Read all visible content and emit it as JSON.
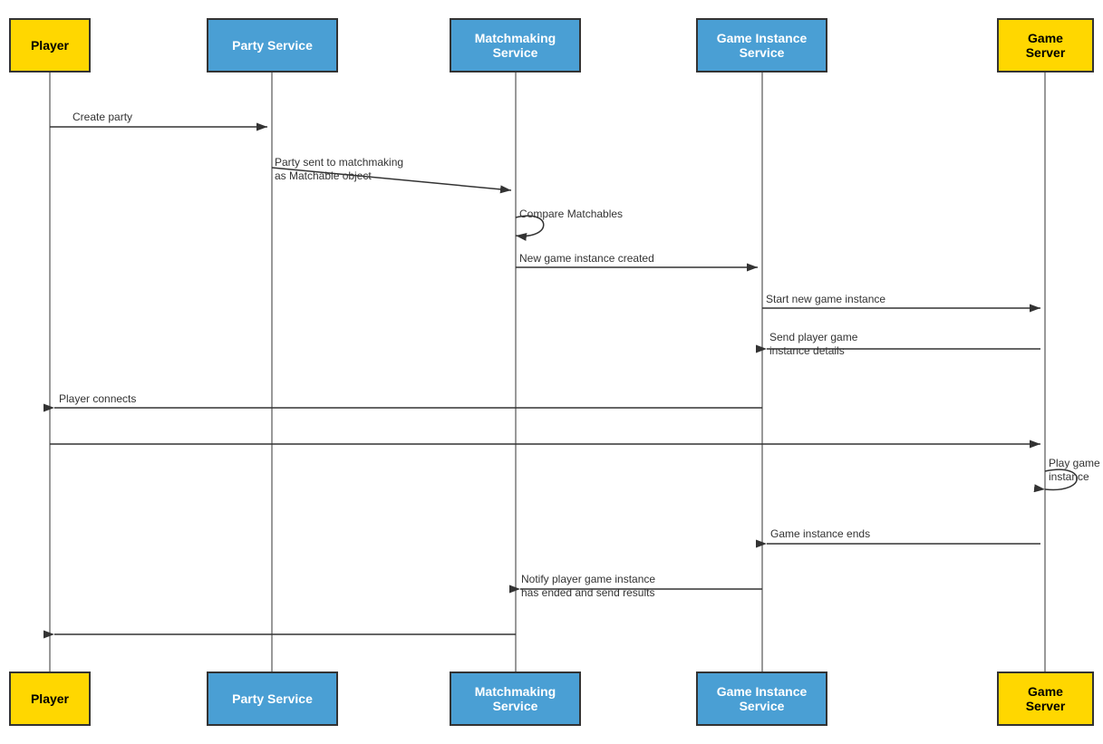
{
  "actors": {
    "player": {
      "label": "Player"
    },
    "partyService": {
      "label": "Party Service"
    },
    "matchmakingService": {
      "label": "Matchmaking\nService"
    },
    "gameInstanceService": {
      "label": "Game Instance\nService"
    },
    "gameServer": {
      "label": "Game Server"
    }
  },
  "messages": {
    "createParty": "Create party",
    "partySentToMatchmaking": "Party sent to matchmaking\nas Matchable object",
    "compareMatchables": "Compare Matchables",
    "newGameInstanceCreated": "New game instance created",
    "startNewGameInstance": "Start new game instance",
    "sendPlayerGameInstanceDetails": "Send player game\ninstance details",
    "playerConnects": "Player connects",
    "playGameInstance": "Play game\ninstance",
    "gameInstanceEnds": "Game instance ends",
    "notifyPlayerGameInstanceEnded": "Notify player game instance\nhas ended and send results"
  }
}
